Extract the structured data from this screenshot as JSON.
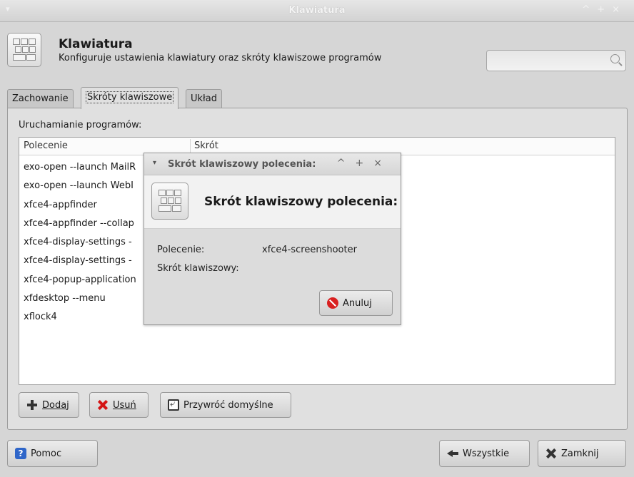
{
  "window": {
    "title": "Klawiatura",
    "menu_glyph": "▾",
    "buttons": [
      "^",
      "+",
      "×"
    ]
  },
  "header": {
    "icon": "keyboard-icon",
    "title": "Klawiatura",
    "subtitle": "Konfiguruje ustawienia klawiatury oraz skróty klawiszowe programów",
    "search_placeholder": ""
  },
  "tabs": [
    {
      "label": "Zachowanie",
      "active": false
    },
    {
      "label": "Skróty klawiszowe",
      "active": true
    },
    {
      "label": "Układ",
      "active": false
    }
  ],
  "shortcuts": {
    "section_label": "Uruchamianie programów:",
    "columns": [
      "Polecenie",
      "Skrót"
    ],
    "rows": [
      "exo-open --launch MailR",
      "exo-open --launch WebI",
      "xfce4-appfinder",
      "xfce4-appfinder --collap",
      "xfce4-display-settings -",
      "xfce4-display-settings -",
      "xfce4-popup-application",
      "xfdesktop --menu",
      "xflock4"
    ],
    "buttons": {
      "add": "Dodaj",
      "remove": "Usuń",
      "reset": "Przywróć domyślne"
    }
  },
  "footer": {
    "help": "Pomoc",
    "all": "Wszystkie",
    "close": "Zamknij"
  },
  "dialog": {
    "title": "Skrót klawiszowy polecenia:",
    "menu_glyph": "▾",
    "buttons": [
      "^",
      "+",
      "×"
    ],
    "heading": "Skrót klawiszowy polecenia:",
    "command_label": "Polecenie:",
    "command_value": "xfce4-screenshooter",
    "shortcut_label": "Skrót klawiszowy:",
    "shortcut_value": "",
    "cancel": "Anuluj"
  },
  "colors": {
    "window_bg": "#d6d6d6",
    "list_bg": "#ffffff",
    "help_blue": "#2f66c9",
    "remove_red": "#d41414",
    "cancel_red": "#d92020"
  }
}
